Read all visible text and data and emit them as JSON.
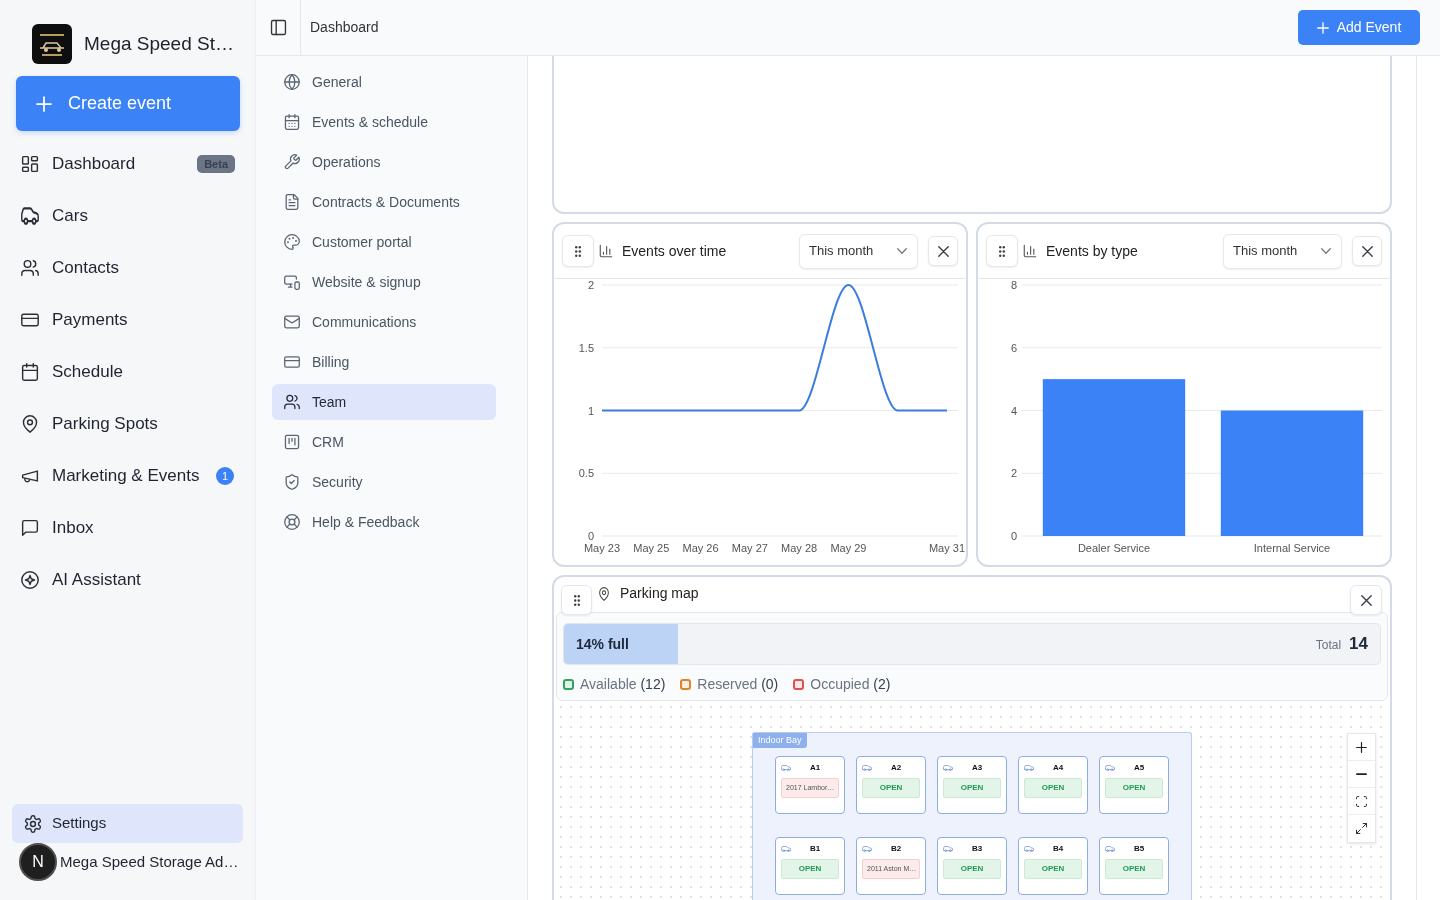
{
  "sidebar": {
    "brand_name": "Mega Speed St…",
    "create_button": "Create event",
    "nav": [
      {
        "label": "Dashboard",
        "selected": false,
        "badge": {
          "kind": "tag",
          "text": "Beta"
        }
      },
      {
        "label": "Cars",
        "selected": false
      },
      {
        "label": "Contacts",
        "selected": false
      },
      {
        "label": "Payments",
        "selected": false
      },
      {
        "label": "Schedule",
        "selected": false
      },
      {
        "label": "Parking Spots",
        "selected": false
      },
      {
        "label": "Marketing & Events",
        "selected": false,
        "badge": {
          "kind": "count",
          "text": "1"
        }
      },
      {
        "label": "Inbox",
        "selected": false
      },
      {
        "label": "AI Assistant",
        "selected": false
      }
    ],
    "footer_nav": [
      {
        "label": "Settings",
        "selected": true
      }
    ],
    "account": {
      "initial": "N",
      "name": "Mega Speed Storage Ad…"
    }
  },
  "topbar": {
    "breadcrumb": "Dashboard",
    "add_button": "Add Event"
  },
  "settings_menu": [
    {
      "label": "General",
      "selected": false
    },
    {
      "label": "Events & schedule",
      "selected": false
    },
    {
      "label": "Operations",
      "selected": false
    },
    {
      "label": "Contracts & Documents",
      "selected": false
    },
    {
      "label": "Customer portal",
      "selected": false
    },
    {
      "label": "Website & signup",
      "selected": false
    },
    {
      "label": "Communications",
      "selected": false
    },
    {
      "label": "Billing",
      "selected": false
    },
    {
      "label": "Team",
      "selected": true
    },
    {
      "label": "CRM",
      "selected": false
    },
    {
      "label": "Security",
      "selected": false
    },
    {
      "label": "Help & Feedback",
      "selected": false
    }
  ],
  "chart_widgets": [
    {
      "title": "Events over time",
      "period": "This month",
      "chart_data": {
        "type": "line",
        "categories": [
          "May 23",
          "May 25",
          "May 26",
          "May 27",
          "May 28",
          "May 29",
          null,
          "May 31"
        ],
        "ylim": [
          0,
          2
        ],
        "yticks": [
          0,
          0.5,
          1,
          1.5,
          2
        ],
        "grid": true,
        "series": [
          {
            "color": "#3b7ddd",
            "values": [
              1,
              1,
              1,
              1,
              1,
              2,
              1,
              1
            ]
          }
        ]
      }
    },
    {
      "title": "Events by type",
      "period": "This month",
      "chart_data": {
        "type": "bar",
        "categories": [
          "Dealer Service",
          "Internal Service"
        ],
        "ylim": [
          0,
          8
        ],
        "yticks": [
          0,
          2,
          4,
          6,
          8
        ],
        "grid": true,
        "series": [
          {
            "color": "#3b82f6",
            "values": [
              5,
              4
            ]
          }
        ]
      }
    }
  ],
  "parking_map": {
    "title": "Parking map",
    "level": 0.14,
    "fill_label": "14% full",
    "total_label": "Total",
    "total": "14",
    "legend": [
      {
        "label": "Available",
        "count": "(12)",
        "color": "#2ea45f"
      },
      {
        "label": "Reserved",
        "count": "(0)",
        "color": "#d9862b"
      },
      {
        "label": "Occupied",
        "count": "(2)",
        "color": "#d9534f"
      }
    ],
    "zone": {
      "name": "Indoor Bay",
      "spots": [
        {
          "label": "A1",
          "kind": "occupied",
          "text": "2017 Lambor…"
        },
        {
          "label": "A2",
          "kind": "open",
          "text": "OPEN"
        },
        {
          "label": "A3",
          "kind": "open",
          "text": "OPEN"
        },
        {
          "label": "A4",
          "kind": "open",
          "text": "OPEN"
        },
        {
          "label": "A5",
          "kind": "open",
          "text": "OPEN"
        },
        {
          "label": "B1",
          "kind": "open",
          "text": "OPEN"
        },
        {
          "label": "B2",
          "kind": "occupied",
          "text": "2011 Aston M…"
        },
        {
          "label": "B3",
          "kind": "open",
          "text": "OPEN"
        },
        {
          "label": "B4",
          "kind": "open",
          "text": "OPEN"
        },
        {
          "label": "B5",
          "kind": "open",
          "text": "OPEN"
        }
      ]
    }
  }
}
